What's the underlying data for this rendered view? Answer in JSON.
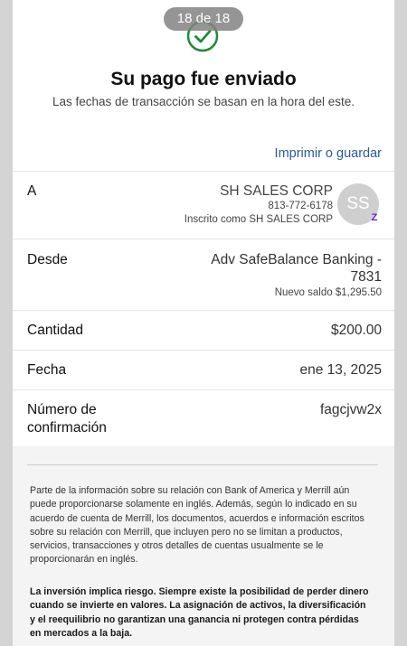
{
  "header": {
    "image_counter": "18 de 18",
    "title": "Su pago fue enviado",
    "subtitle": "Las fechas de transacción se basan en la hora del este.",
    "print_link": "Imprimir o guardar",
    "status_icon": "checkmark-circle-icon",
    "accent_color": "#2a5a9e",
    "success_color": "#1f8a3a"
  },
  "recipient": {
    "label": "A",
    "name": "SH SALES CORP",
    "phone": "813-772-6178",
    "enrolled": "Inscrito como SH SALES CORP",
    "avatar_initials": "SS",
    "badge_icon": "zelle-icon",
    "badge_glyph": "Z"
  },
  "source": {
    "label": "Desde",
    "account_line1": "Adv SafeBalance Banking -",
    "account_line2": "7831",
    "new_balance": "Nuevo saldo $1,295.50"
  },
  "amount": {
    "label": "Cantidad",
    "value": "$200.00"
  },
  "date": {
    "label": "Fecha",
    "value": "ene 13, 2025"
  },
  "confirmation": {
    "label_line1": "Número de",
    "label_line2": "confirmación",
    "value": "fagcjvw2x"
  },
  "footer": {
    "disclaimer": "Parte de la información sobre su relación con Bank of America y Merrill aún puede proporcionarse solamente en inglés. Además, según lo indicado en su acuerdo de cuenta de Merrill, los documentos, acuerdos e información escritos sobre su relación con Merrill, que incluyen pero no se limitan a productos, servicios, transacciones y otros detalles de cuentas usualmente se le proporcionarán en inglés.",
    "risk": "La inversión implica riesgo. Siempre existe la posibilidad de perder dinero cuando se invierte en valores. La asignación de activos, la diversificación y el reequilibrio no garantizan una ganancia ni protegen contra pérdidas en mercados a la baja."
  }
}
